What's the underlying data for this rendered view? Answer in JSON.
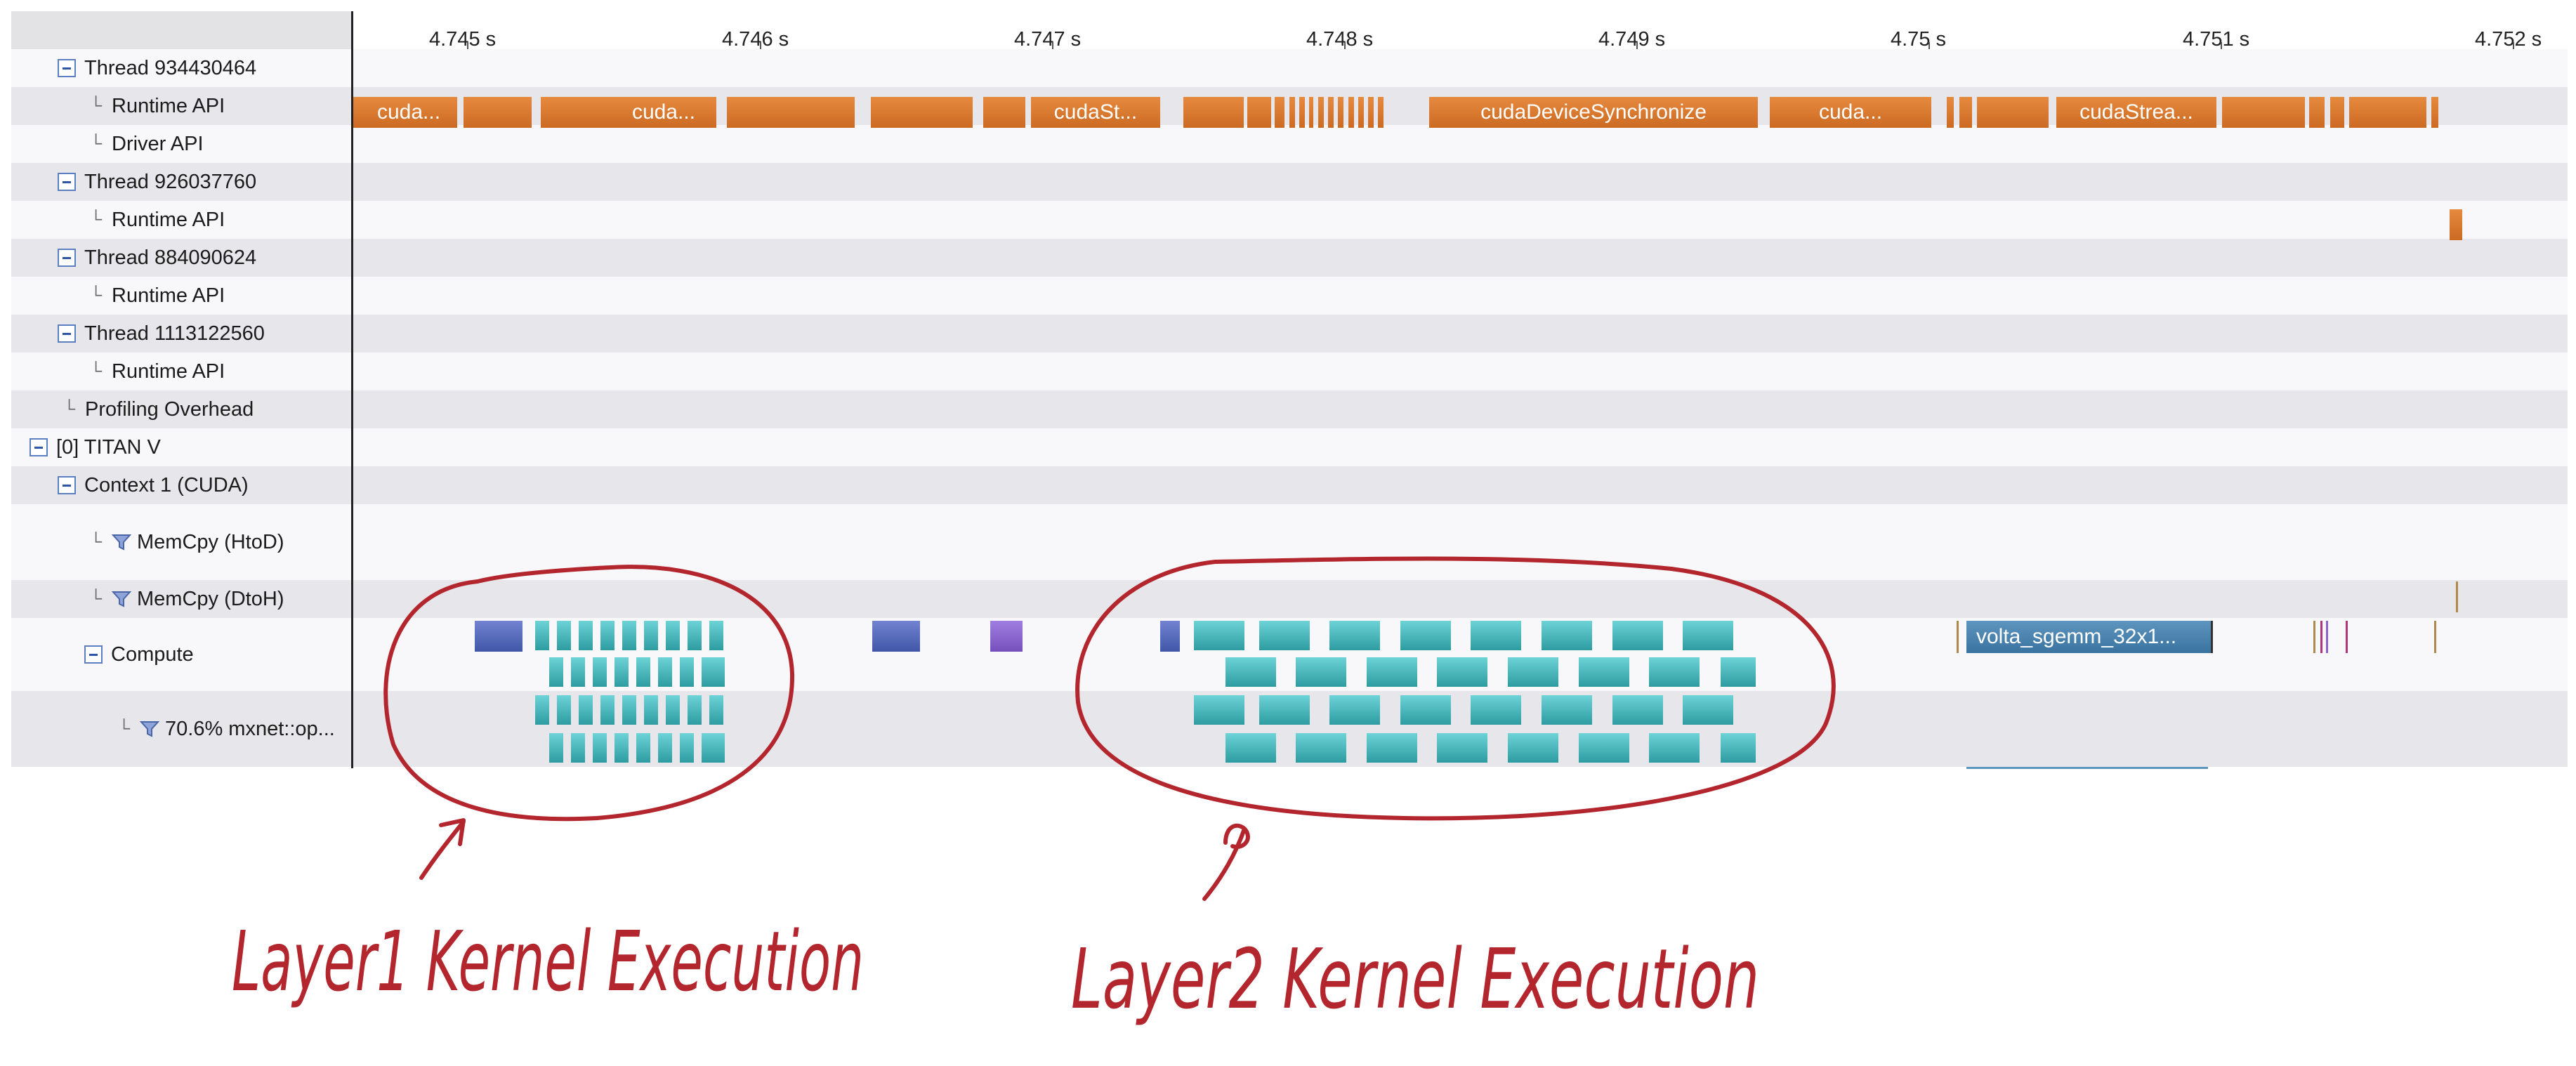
{
  "ruler": {
    "ticks": [
      "4.745 s",
      "4.746 s",
      "4.747 s",
      "4.748 s",
      "4.749 s",
      "4.75 s",
      "4.751 s",
      "4.752 s"
    ]
  },
  "tree": {
    "rows": [
      {
        "label": "Thread 934430464"
      },
      {
        "label": "Runtime API"
      },
      {
        "label": "Driver API"
      },
      {
        "label": "Thread 926037760"
      },
      {
        "label": "Runtime API"
      },
      {
        "label": "Thread 884090624"
      },
      {
        "label": "Runtime API"
      },
      {
        "label": "Thread 1113122560"
      },
      {
        "label": "Runtime API"
      },
      {
        "label": "Profiling Overhead"
      },
      {
        "label": "[0] TITAN V"
      },
      {
        "label": "Context 1 (CUDA)"
      },
      {
        "label": "MemCpy (HtoD)"
      },
      {
        "label": "MemCpy (DtoH)"
      },
      {
        "label": "Compute"
      },
      {
        "label": "70.6% mxnet::op..."
      }
    ]
  },
  "timeline": {
    "runtime_api_labels": [
      "cuda...",
      "cuda...",
      "cudaSt...",
      "cudaDeviceSynchronize",
      "cuda...",
      "cudaStrea..."
    ],
    "volta_kernel_label": "volta_sgemm_32x1...",
    "colors": {
      "runtime_api": "#d9762c",
      "kernel": "#3fb3b8",
      "memcpy": "#4a5fb4",
      "purple": "#8a63cc",
      "annotation": "#b3262d"
    }
  },
  "annotations": {
    "layer1": "Layer1  Kernel Execution",
    "layer2": "Layer2  Kernel Execution"
  }
}
